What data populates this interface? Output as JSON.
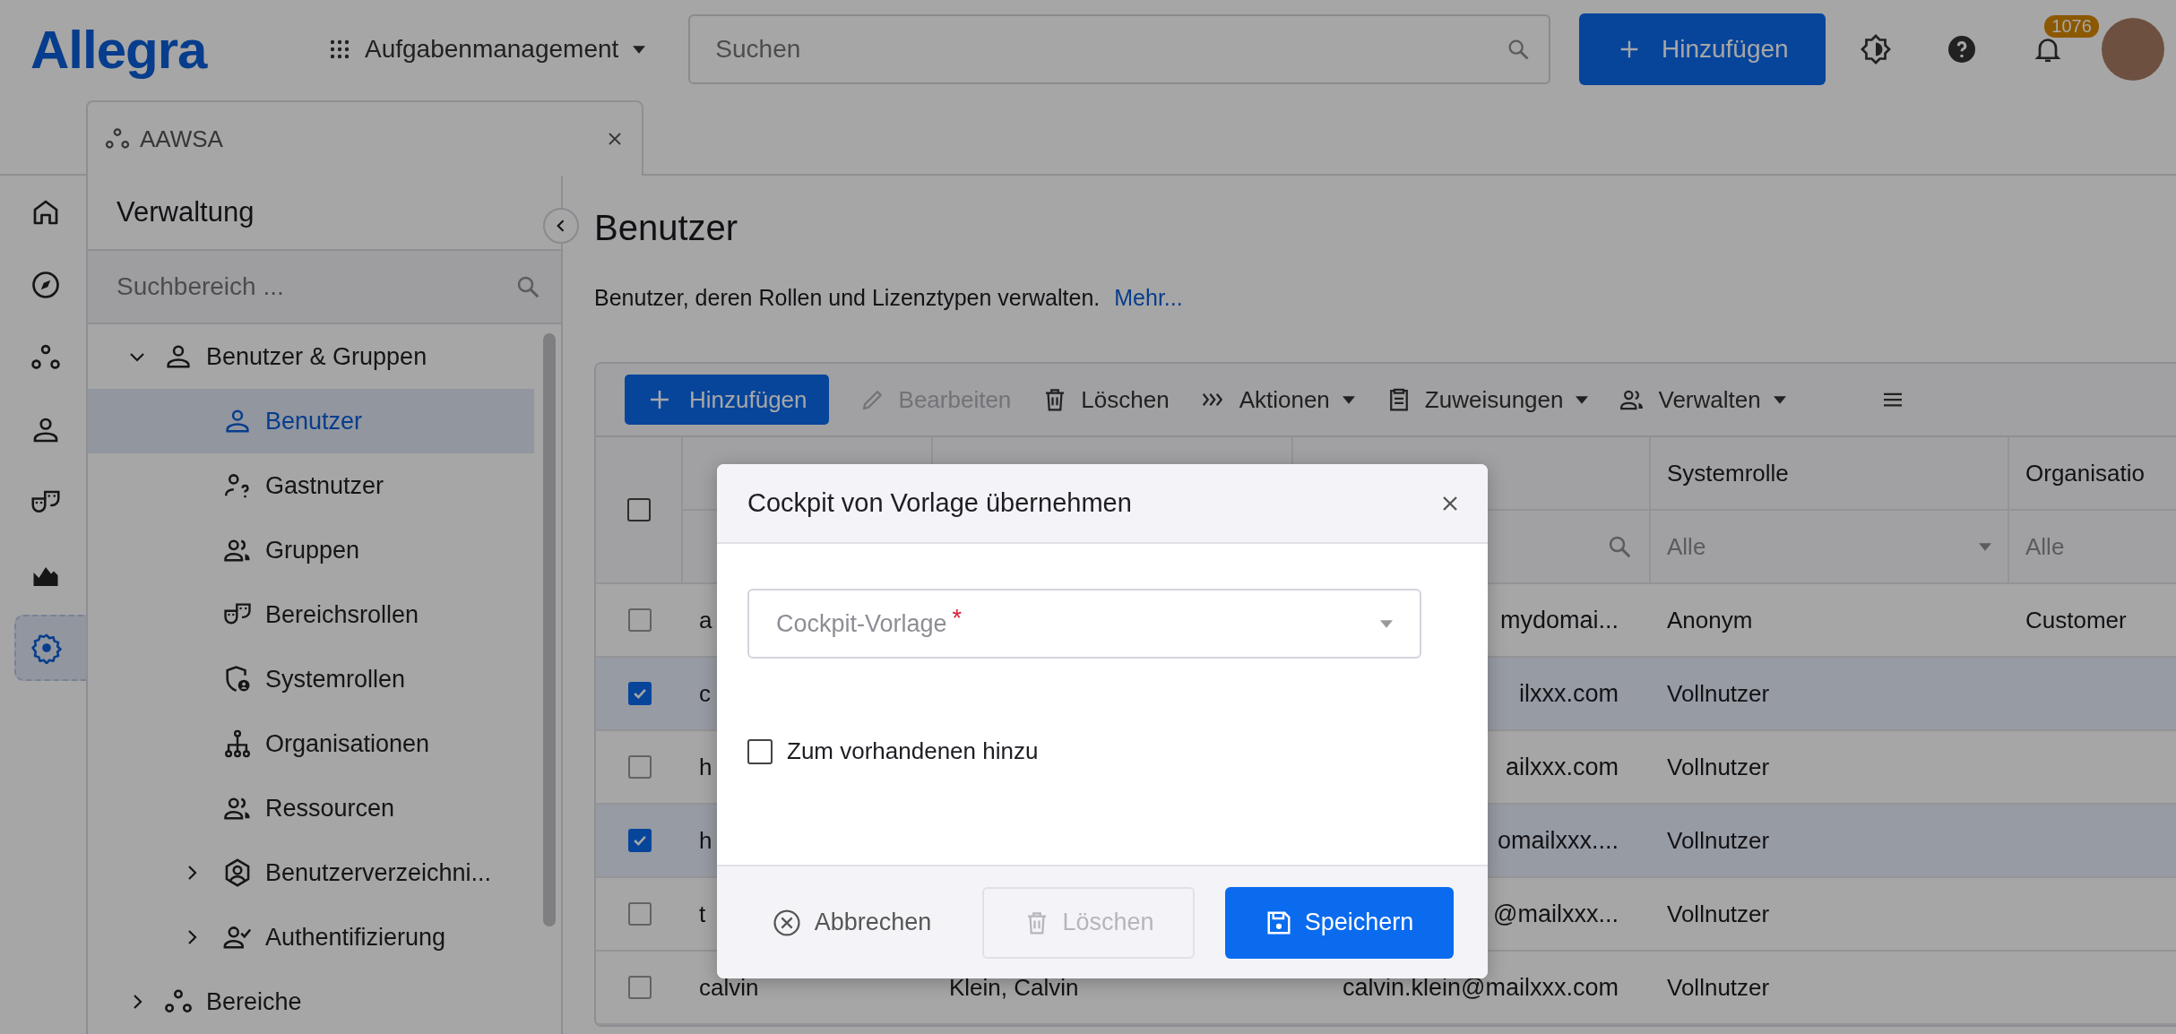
{
  "header": {
    "logo": "Allegra",
    "app_switcher": "Aufgabenmanagement",
    "search": {
      "placeholder": "Suchen"
    },
    "add_button": "Hinzufügen",
    "notification_count": "1076"
  },
  "tabs": [
    {
      "label": "AAWSA",
      "selected": true
    }
  ],
  "rail": [
    {
      "selected": false
    },
    {
      "selected": false
    },
    {
      "selected": false
    },
    {
      "selected": false
    },
    {
      "selected": false
    },
    {
      "selected": false
    },
    {
      "selected": true
    }
  ],
  "sidebar": {
    "title": "Verwaltung",
    "search": {
      "placeholder": "Suchbereich ..."
    },
    "tree": [
      {
        "label": "Benutzer & Gruppen",
        "kind": "group",
        "expanded": true,
        "children": [
          {
            "label": "Benutzer",
            "kind": "leaf",
            "selected": true
          },
          {
            "label": "Gastnutzer",
            "kind": "leaf",
            "selected": false
          },
          {
            "label": "Gruppen",
            "kind": "leaf",
            "selected": false
          },
          {
            "label": "Bereichsrollen",
            "kind": "leaf",
            "selected": false
          },
          {
            "label": "Systemrollen",
            "kind": "leaf",
            "selected": false
          },
          {
            "label": "Organisationen",
            "kind": "leaf",
            "selected": false
          },
          {
            "label": "Ressourcen",
            "kind": "leaf",
            "selected": false
          },
          {
            "label": "Benutzerverzeichni...",
            "kind": "group",
            "expanded": false
          },
          {
            "label": "Authentifizierung",
            "kind": "group",
            "expanded": false
          }
        ]
      },
      {
        "label": "Bereiche",
        "kind": "group",
        "expanded": false
      }
    ]
  },
  "page": {
    "title": "Benutzer",
    "description": "Benutzer, deren Rollen und Lizenztypen verwalten.",
    "more_link": "Mehr..."
  },
  "toolbar": [
    {
      "label": "Hinzufügen",
      "kind": "primary",
      "disabled": false,
      "menu": false
    },
    {
      "label": "Bearbeiten",
      "kind": "plain",
      "disabled": true,
      "menu": false
    },
    {
      "label": "Löschen",
      "kind": "plain",
      "disabled": false,
      "menu": false
    },
    {
      "label": "Aktionen",
      "kind": "plain",
      "disabled": false,
      "menu": true
    },
    {
      "label": "Zuweisungen",
      "kind": "plain",
      "disabled": false,
      "menu": true
    },
    {
      "label": "Verwalten",
      "kind": "plain",
      "disabled": false,
      "menu": true
    }
  ],
  "table": {
    "select_all": {
      "checked": false
    },
    "columns": [
      {},
      {},
      {
        "filter": {
          "kind": "search"
        }
      },
      {
        "label": "Systemrolle",
        "filter": {
          "kind": "dropdown",
          "value": "Alle"
        }
      },
      {
        "label": "Organisatio",
        "filter": {
          "kind": "text",
          "value": "Alle"
        }
      }
    ],
    "rows": [
      {
        "selected": false,
        "cells": {
          "column_1": "a",
          "column_3": "mydomai...",
          "column_4": "Anonym",
          "column_5": "Customer"
        }
      },
      {
        "selected": true,
        "cells": {
          "column_1": "c",
          "column_3": "ilxxx.com",
          "column_4": "Vollnutzer"
        }
      },
      {
        "selected": false,
        "cells": {
          "column_1": "h",
          "column_3": "ailxxx.com",
          "column_4": "Vollnutzer"
        }
      },
      {
        "selected": true,
        "cells": {
          "column_1": "h",
          "column_3": "omailxxx....",
          "column_4": "Vollnutzer"
        }
      },
      {
        "selected": false,
        "cells": {
          "column_1": "t",
          "column_3": "@mailxxx...",
          "column_4": "Vollnutzer"
        }
      },
      {
        "selected": false,
        "cells": {
          "column_1": "calvin",
          "column_2": "Klein, Calvin",
          "column_3": "calvin.klein@mailxxx.com",
          "column_4": "Vollnutzer"
        }
      }
    ]
  },
  "dialog": {
    "title": "Cockpit von Vorlage übernehmen",
    "field": {
      "placeholder": "Cockpit-Vorlage",
      "required_mark": "*"
    },
    "checkbox": {
      "label": "Zum vorhandenen hinzu",
      "checked": false
    },
    "buttons": [
      {
        "label": "Abbrechen",
        "kind": "cancel",
        "disabled": false
      },
      {
        "label": "Löschen",
        "kind": "delete",
        "disabled": true
      },
      {
        "label": "Speichern",
        "kind": "save",
        "disabled": false
      }
    ]
  }
}
